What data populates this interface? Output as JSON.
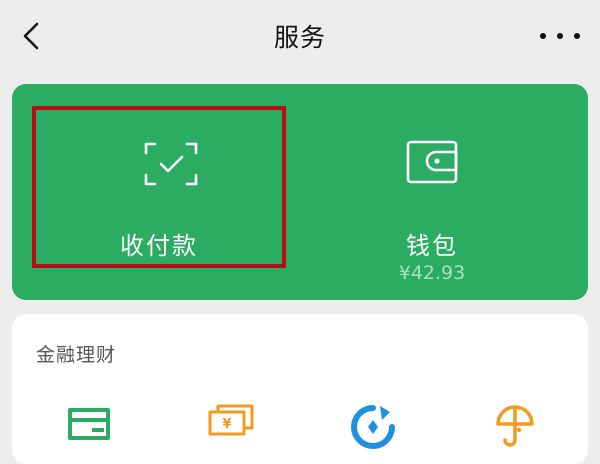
{
  "header": {
    "title": "服务",
    "back_icon": "chevron-left-icon",
    "more_icon": "more-dots-icon"
  },
  "services": {
    "pay": {
      "label": "收付款",
      "icon": "scan-check-icon",
      "highlight_color": "#b80f16"
    },
    "wallet": {
      "label": "钱包",
      "balance": "¥42.93",
      "icon": "wallet-icon"
    },
    "card_color": "#2bac62"
  },
  "finance": {
    "title": "金融理财",
    "icons": [
      "credit-card-icon",
      "cash-icon",
      "wealth-icon",
      "insurance-icon"
    ]
  }
}
